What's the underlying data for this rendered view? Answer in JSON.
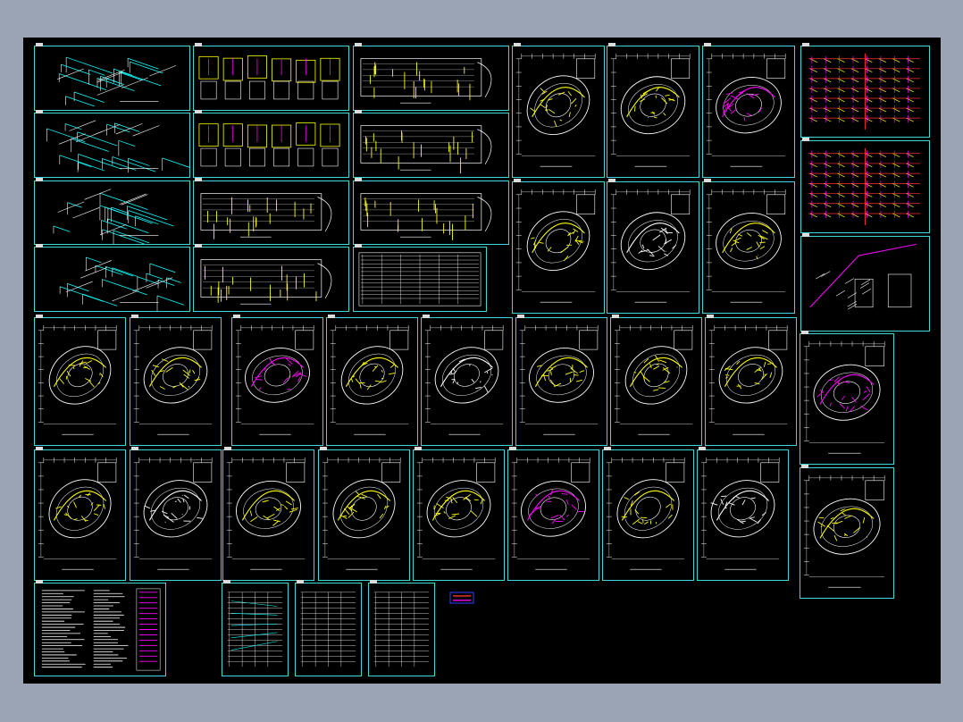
{
  "canvas": {
    "background": "#000000",
    "frame_color": "#3fd6d6"
  },
  "palette": {
    "yellow": "#ffff00",
    "white": "#ffffff",
    "cyan": "#00ffff",
    "magenta": "#ff00ff",
    "red": "#ff3030",
    "green": "#00e000",
    "blue": "#3040ff"
  },
  "sheets": [
    {
      "id": "iso-1",
      "kind": "isometric"
    },
    {
      "id": "iso-2",
      "kind": "isometric"
    },
    {
      "id": "iso-3",
      "kind": "isometric"
    },
    {
      "id": "iso-4",
      "kind": "isometric"
    },
    {
      "id": "detail-1",
      "kind": "details"
    },
    {
      "id": "detail-2",
      "kind": "details"
    },
    {
      "id": "long-plan-1",
      "kind": "long-plan"
    },
    {
      "id": "long-plan-2",
      "kind": "long-plan"
    },
    {
      "id": "long-plan-3",
      "kind": "long-plan"
    },
    {
      "id": "long-plan-4",
      "kind": "long-plan"
    },
    {
      "id": "long-plan-5",
      "kind": "long-plan"
    },
    {
      "id": "long-plan-6",
      "kind": "long-plan"
    },
    {
      "id": "table-1",
      "kind": "table"
    },
    {
      "id": "plan-r1-1",
      "kind": "curved-plan"
    },
    {
      "id": "plan-r1-2",
      "kind": "curved-plan"
    },
    {
      "id": "plan-r1-3",
      "kind": "curved-plan"
    },
    {
      "id": "plan-r2-1",
      "kind": "curved-plan"
    },
    {
      "id": "plan-r2-2",
      "kind": "curved-plan"
    },
    {
      "id": "plan-r2-3",
      "kind": "curved-plan"
    },
    {
      "id": "system-1",
      "kind": "system"
    },
    {
      "id": "system-2",
      "kind": "system"
    },
    {
      "id": "riser-1",
      "kind": "riser"
    },
    {
      "id": "plan-r3-1",
      "kind": "curved-plan"
    },
    {
      "id": "plan-r3-2",
      "kind": "curved-plan"
    },
    {
      "id": "plan-r3-3",
      "kind": "curved-plan"
    },
    {
      "id": "plan-r3-4",
      "kind": "curved-plan"
    },
    {
      "id": "plan-r3-5",
      "kind": "curved-plan"
    },
    {
      "id": "plan-r3-6",
      "kind": "curved-plan"
    },
    {
      "id": "plan-r3-7",
      "kind": "curved-plan"
    },
    {
      "id": "plan-r3-8",
      "kind": "curved-plan"
    },
    {
      "id": "plan-r3-9",
      "kind": "curved-plan"
    },
    {
      "id": "plan-r4-1",
      "kind": "curved-plan"
    },
    {
      "id": "plan-r4-2",
      "kind": "curved-plan"
    },
    {
      "id": "plan-r4-3",
      "kind": "curved-plan"
    },
    {
      "id": "plan-r4-4",
      "kind": "curved-plan"
    },
    {
      "id": "plan-r4-5",
      "kind": "curved-plan"
    },
    {
      "id": "plan-r4-6",
      "kind": "curved-plan"
    },
    {
      "id": "plan-r4-7",
      "kind": "curved-plan"
    },
    {
      "id": "plan-r4-8",
      "kind": "curved-plan"
    },
    {
      "id": "plan-r4-9",
      "kind": "curved-plan"
    },
    {
      "id": "notes-1",
      "kind": "notes"
    },
    {
      "id": "schedule-1",
      "kind": "schedule"
    },
    {
      "id": "schedule-2",
      "kind": "schedule"
    },
    {
      "id": "schedule-3",
      "kind": "schedule"
    },
    {
      "id": "legend-1",
      "kind": "legend"
    }
  ]
}
